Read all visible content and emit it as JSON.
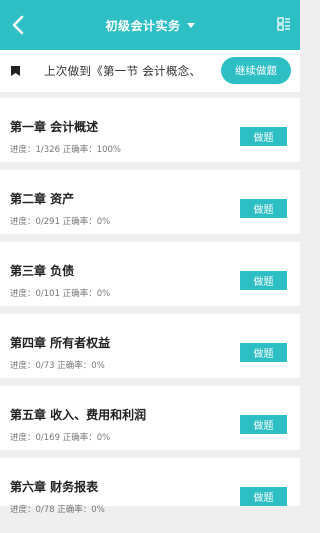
{
  "header": {
    "title": "初级会计实务",
    "back_icon": "chevron-left-icon",
    "caret_icon": "caret-down-icon",
    "menu_icon": "list-menu-icon",
    "bg_color": "#2ebfc4"
  },
  "resume": {
    "text": "上次做到《第一节 会计概念、",
    "button_label": "继续做题",
    "icon": "bookmark-icon"
  },
  "chapters": [
    {
      "title": "第一章 会计概述",
      "meta": "进度：1/326 正确率：100%",
      "button": "做题"
    },
    {
      "title": "第二章 资产",
      "meta": "进度：0/291 正确率：0%",
      "button": "做题"
    },
    {
      "title": "第三章 负债",
      "meta": "进度：0/101 正确率：0%",
      "button": "做题"
    },
    {
      "title": "第四章 所有者权益",
      "meta": "进度：0/73 正确率：0%",
      "button": "做题"
    },
    {
      "title": "第五章 收入、费用和利润",
      "meta": "进度：0/169 正确率：0%",
      "button": "做题"
    },
    {
      "title": "第六章 财务报表",
      "meta": "进度：0/78 正确率：0%",
      "button": "做题"
    }
  ]
}
